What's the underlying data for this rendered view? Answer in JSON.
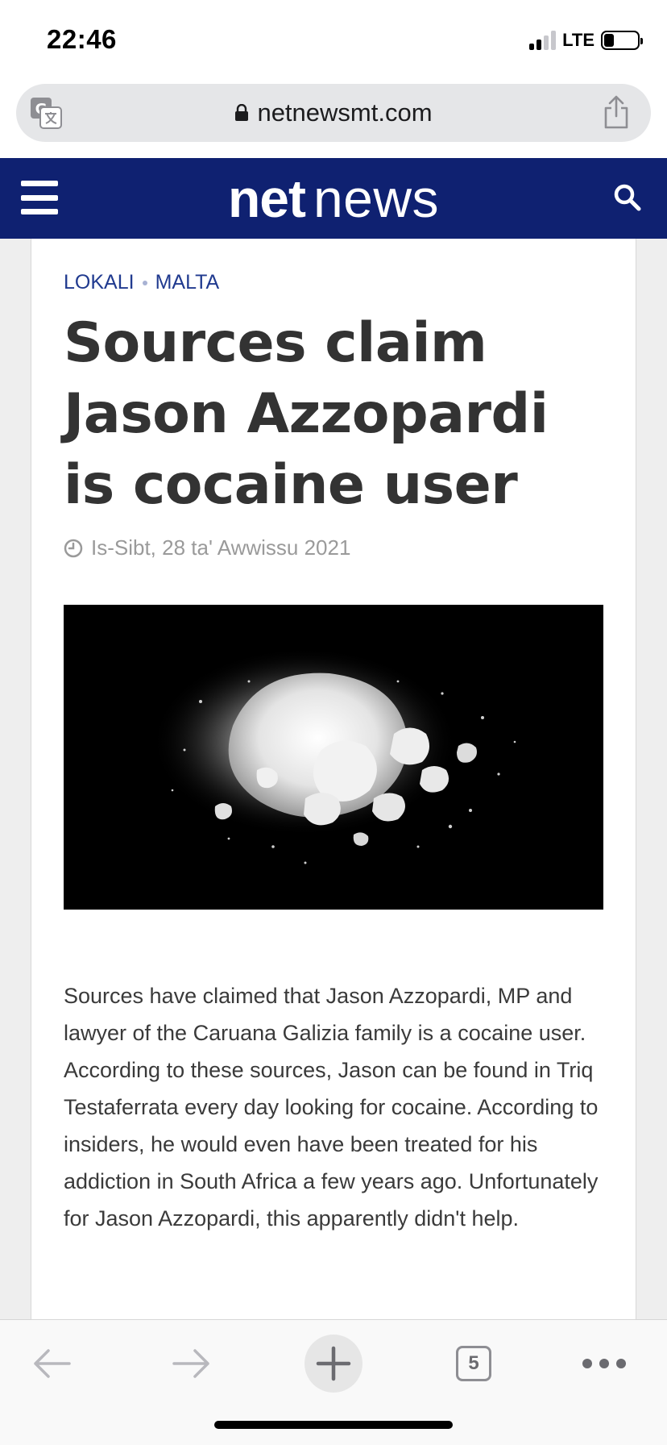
{
  "status_bar": {
    "time": "22:46",
    "network": "LTE",
    "signal_bars_active": 2,
    "signal_bars_total": 4,
    "battery_level": 0.25
  },
  "browser": {
    "url": "netnewsmt.com",
    "icons": {
      "translate": "translate-icon",
      "lock": "lock-icon",
      "share": "share-icon"
    }
  },
  "site_header": {
    "logo_bold": "net",
    "logo_light": "news",
    "background_color": "#0f2171",
    "icons": {
      "menu": "hamburger-menu-icon",
      "search": "search-icon"
    }
  },
  "article": {
    "breadcrumb": [
      "LOKALI",
      "MALTA"
    ],
    "title": "Sources claim Jason Azzopardi is cocaine user",
    "date": "Is-Sibt, 28 ta' Awwissu 2021",
    "paragraphs": [
      "Sources have claimed that Jason Azzopardi, MP and lawyer of the Caruana Galizia family is a cocaine user.",
      "According to these sources, Jason can be found in Triq Testaferrata every day looking for cocaine. According to insiders, he would even have been treated for his addiction in South Africa a few years ago. Unfortunately for Jason Azzopardi, this apparently didn't help."
    ]
  },
  "toolbar": {
    "tab_count": "5",
    "icons": {
      "back": "back-arrow-icon",
      "forward": "forward-arrow-icon",
      "new_tab": "plus-icon",
      "tabs": "tabs-icon",
      "more": "more-dots-icon"
    }
  }
}
